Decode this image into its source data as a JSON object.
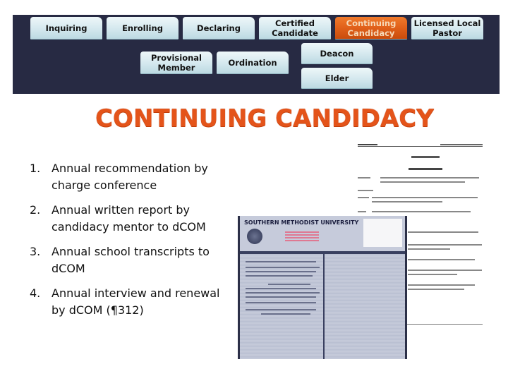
{
  "pathway": {
    "steps": [
      {
        "id": "inquiring",
        "label": "Inquiring",
        "active": false
      },
      {
        "id": "enrolling",
        "label": "Enrolling",
        "active": false
      },
      {
        "id": "declaring",
        "label": "Declaring",
        "active": false
      },
      {
        "id": "certified",
        "label_line1": "Certified",
        "label_line2": "Candidate",
        "active": false
      },
      {
        "id": "continuing",
        "label_line1": "Continuing",
        "label_line2": "Candidacy",
        "active": true
      },
      {
        "id": "licensed",
        "label_line1": "Licensed Local",
        "label_line2": "Pastor",
        "active": false
      },
      {
        "id": "provisional",
        "label_line1": "Provisional",
        "label_line2": "Member",
        "active": false
      },
      {
        "id": "ordination",
        "label": "Ordination",
        "active": false
      },
      {
        "id": "deacon",
        "label": "Deacon",
        "active": false
      },
      {
        "id": "elder",
        "label": "Elder",
        "active": false
      }
    ],
    "colors": {
      "background": "#272a43",
      "step": "#d4e8ee",
      "active": "#e0601a"
    }
  },
  "title": "CONTINUING CANDIDACY",
  "requirements": [
    {
      "num": "1.",
      "text": "Annual recommendation by charge conference"
    },
    {
      "num": "2.",
      "text": "Annual written report by candidacy mentor to dCOM"
    },
    {
      "num": "3.",
      "text": "Annual school transcripts to dCOM"
    },
    {
      "num": "4.",
      "text": "Annual interview and renewal by dCOM (¶312)"
    }
  ],
  "images": {
    "transcript": {
      "university": "SOUTHERN METHODIST UNIVERSITY"
    },
    "letter": {
      "description": "Action Guideline document - Candidacy Renewal"
    }
  }
}
